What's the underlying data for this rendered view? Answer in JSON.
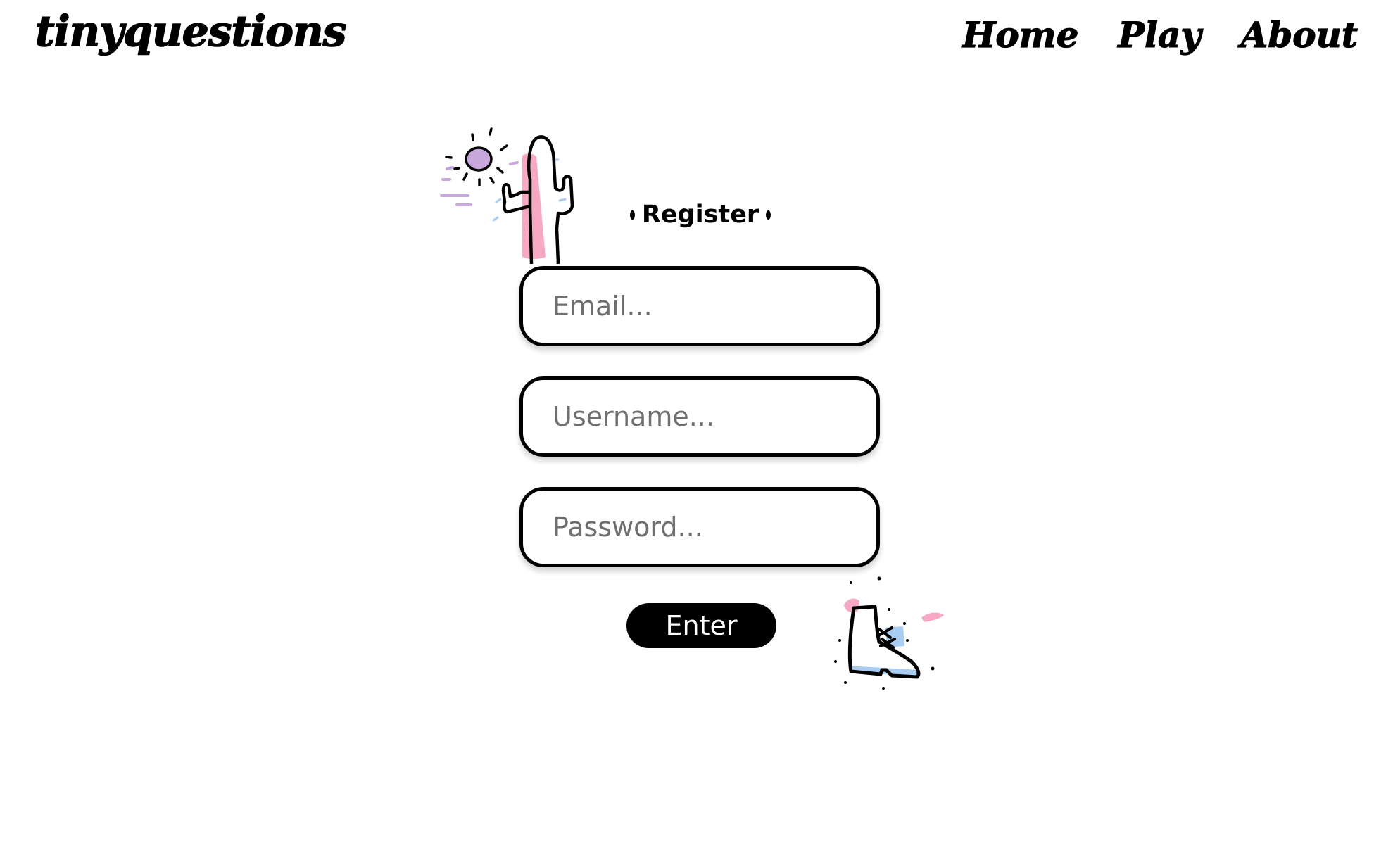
{
  "header": {
    "logo": "tinyquestions",
    "nav": [
      "Home",
      "Play",
      "About"
    ]
  },
  "form": {
    "title": "Register",
    "email_placeholder": "Email...",
    "username_placeholder": "Username...",
    "password_placeholder": "Password...",
    "submit_label": "Enter"
  },
  "icons": {
    "decoration_1": "cactus-sun-doodle",
    "decoration_2": "boot-doodle"
  },
  "colors": {
    "text": "#000000",
    "background": "#ffffff",
    "accent_pink": "#f7a8c4",
    "accent_blue": "#a9ccf2",
    "accent_purple": "#c8a8dc"
  }
}
